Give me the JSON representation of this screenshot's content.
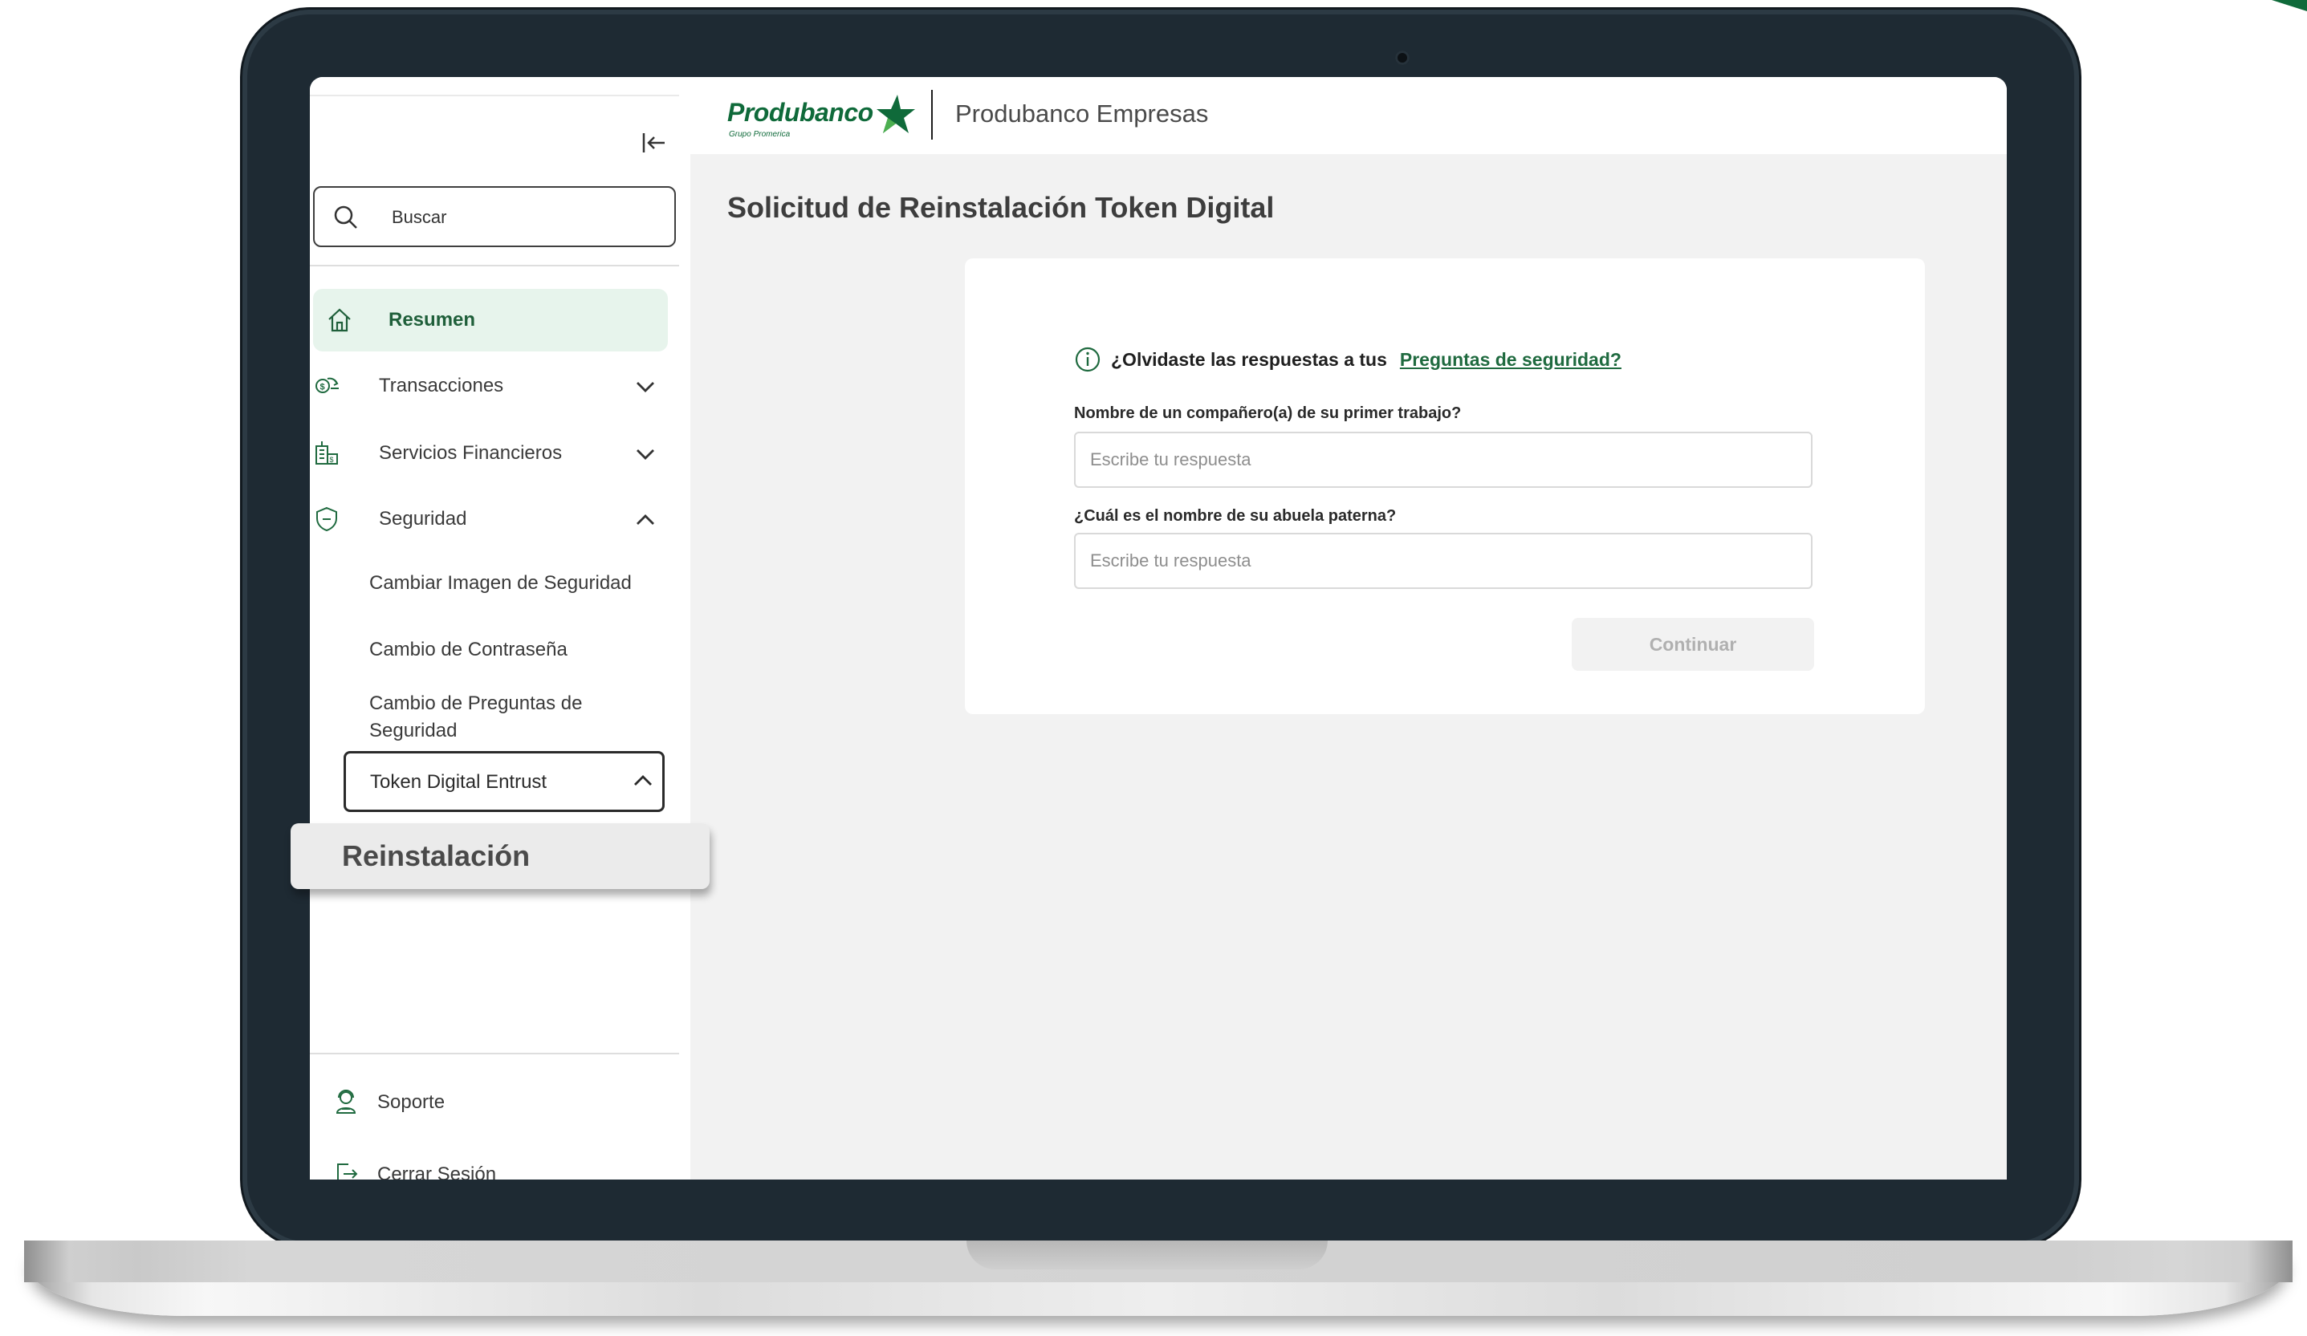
{
  "brand": {
    "logo_text": "Produbanco",
    "logo_subtext": "Grupo Promerica",
    "app_title": "Produbanco Empresas",
    "primary_color": "#0f6a3a",
    "accent_light": "#e7f4ec"
  },
  "sidebar": {
    "search": {
      "placeholder": "Buscar",
      "icon": "search-icon"
    },
    "items": [
      {
        "label": "Resumen",
        "icon": "home-icon",
        "active": true
      },
      {
        "label": "Transacciones",
        "icon": "transfer-icon",
        "expanded": false
      },
      {
        "label": "Servicios Financieros",
        "icon": "building-icon",
        "expanded": false
      },
      {
        "label": "Seguridad",
        "icon": "shield-icon",
        "expanded": true
      }
    ],
    "security_subitems": [
      "Cambiar Imagen de Seguridad",
      "Cambio de Contraseña",
      "Cambio de Preguntas de Seguridad"
    ],
    "token_item": {
      "label": "Token Digital Entrust",
      "expanded": true
    },
    "bottom_items": [
      {
        "label": "Soporte",
        "icon": "support-agent-icon"
      },
      {
        "label": "Cerrar Sesión",
        "icon": "logout-icon"
      }
    ]
  },
  "popover": {
    "label": "Reinstalación"
  },
  "main": {
    "page_title": "Solicitud de Reinstalación Token Digital",
    "info": {
      "text": "¿Olvidaste las respuestas a tus",
      "link": "Preguntas de seguridad?"
    },
    "questions": [
      {
        "label": "Nombre de un compañero(a) de su primer trabajo?",
        "placeholder": "Escribe tu respuesta",
        "value": ""
      },
      {
        "label": "¿Cuál es el nombre de su abuela paterna?",
        "placeholder": "Escribe tu respuesta",
        "value": ""
      }
    ],
    "continue_button": "Continuar"
  }
}
